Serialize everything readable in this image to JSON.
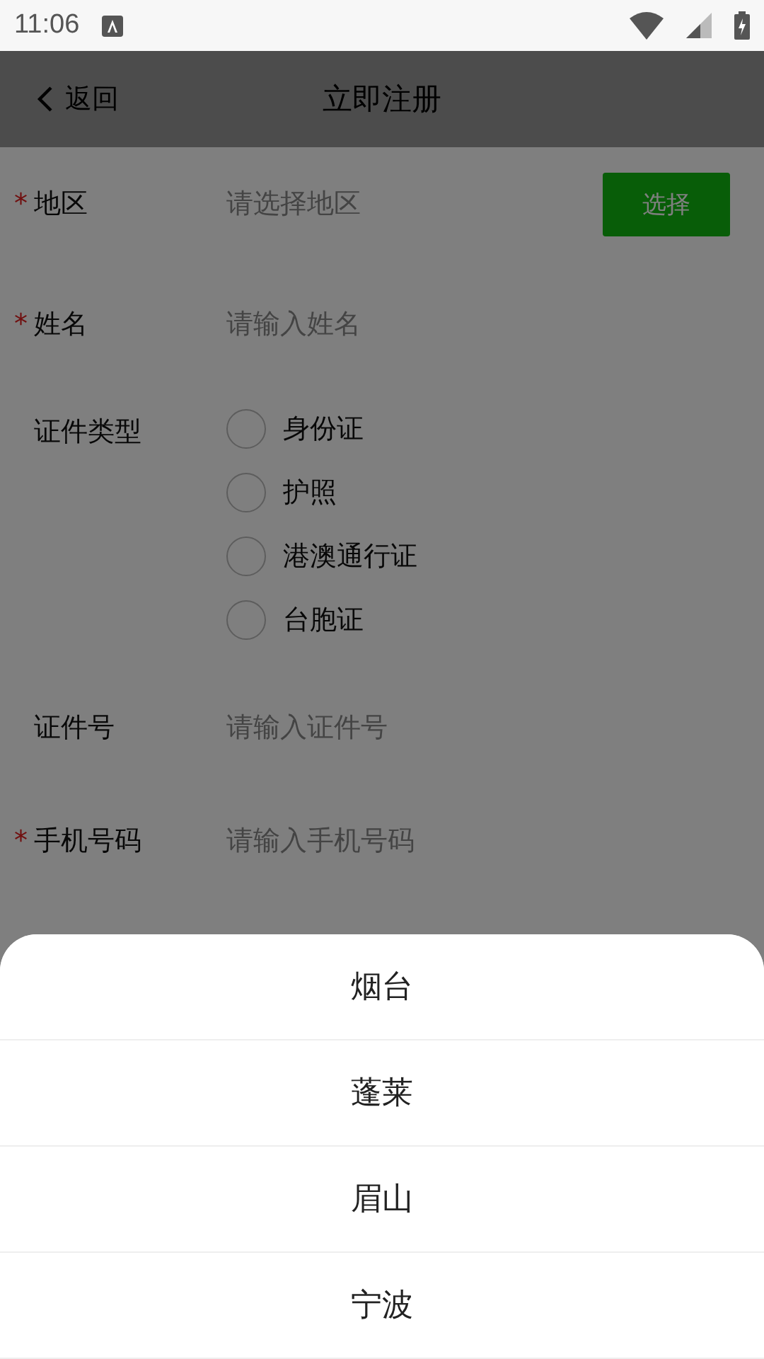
{
  "status_bar": {
    "time": "11:06"
  },
  "header": {
    "back": "返回",
    "title": "立即注册"
  },
  "form": [
    {
      "kind": "select",
      "label": "地区",
      "mark": "*",
      "placeholder": "请选择地区",
      "button": "选择"
    },
    {
      "kind": "input",
      "label": "姓名",
      "mark": "*",
      "placeholder": "请输入姓名"
    },
    {
      "kind": "radio",
      "label": "证件类型",
      "options": [
        {
          "label": "身份证",
          "selected": false
        },
        {
          "label": "护照",
          "selected": false
        },
        {
          "label": "港澳通行证",
          "selected": false
        },
        {
          "label": "台胞证",
          "selected": false
        }
      ]
    },
    {
      "kind": "input",
      "label": "证件号",
      "placeholder": "请输入证件号"
    },
    {
      "kind": "input",
      "label": "手机号码",
      "mark": "*",
      "placeholder": "请输入手机号码"
    }
  ],
  "sheet": {
    "items": [
      "烟台",
      "蓬莱",
      "眉山",
      "宁波"
    ]
  }
}
